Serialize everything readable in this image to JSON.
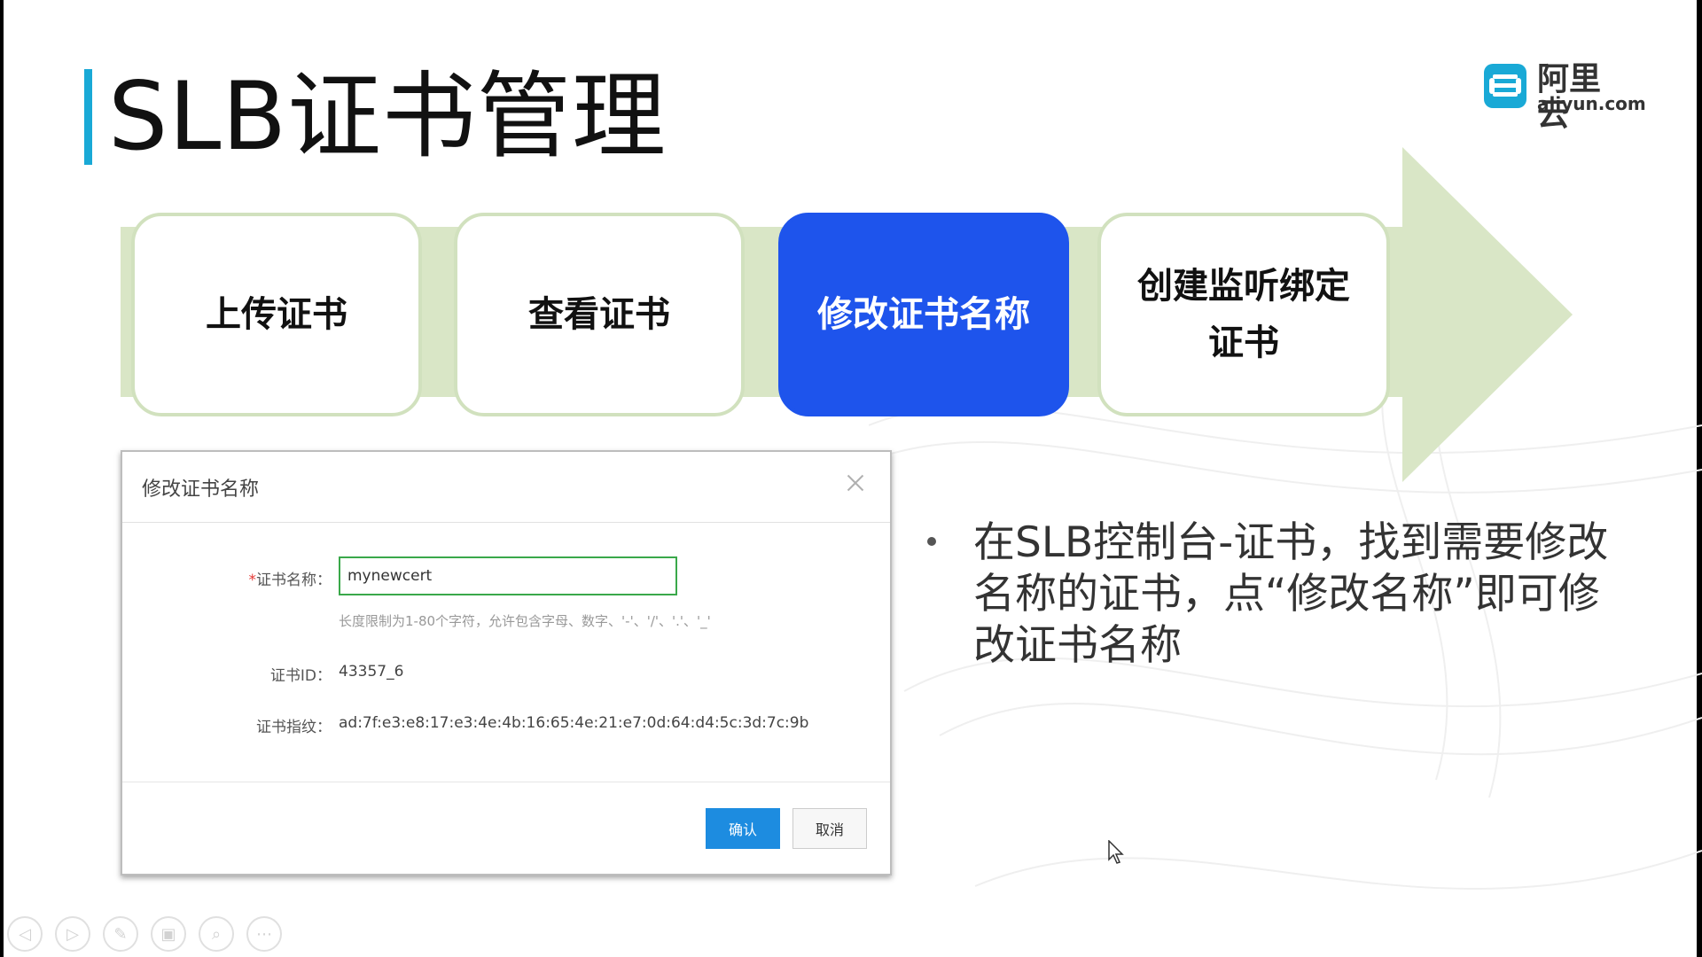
{
  "slide": {
    "title": "SLB证书管理",
    "accent_color": "#19a9d6"
  },
  "logo": {
    "cn": "阿里云",
    "en": "aliyun.com",
    "icon": "aliyun-logo-icon",
    "color": "#19a9d6"
  },
  "flow": {
    "band_color": "#d9e6c6",
    "active_color": "#1e54ec",
    "steps": [
      {
        "label": "上传证书",
        "active": false
      },
      {
        "label": "查看证书",
        "active": false
      },
      {
        "label": "修改证书名称",
        "active": true
      },
      {
        "label": "创建监听绑定证书",
        "active": false
      }
    ]
  },
  "dialog": {
    "title": "修改证书名称",
    "close_icon": "close-icon",
    "name_label_required": "*",
    "name_label": "证书名称：",
    "name_value": "mynewcert",
    "name_hint": "长度限制为1-80个字符，允许包含字母、数字、'-'、'/'、'.'、'_'",
    "id_label": "证书ID：",
    "id_value": "43357_6",
    "fingerprint_label": "证书指纹：",
    "fingerprint_value": "ad:7f:e3:e8:17:e3:4e:4b:16:65:4e:21:e7:0d:64:d4:5c:3d:7c:9b",
    "confirm_label": "确认",
    "cancel_label": "取消",
    "confirm_color": "#1d8ce0",
    "input_border_color": "#3aa84a"
  },
  "bullet": {
    "text": "在SLB控制台-证书，找到需要修改名称的证书，点“修改名称”即可修改证书名称"
  },
  "nav": {
    "buttons": [
      {
        "icon": "previous-icon",
        "glyph": "◁"
      },
      {
        "icon": "next-icon",
        "glyph": "▷"
      },
      {
        "icon": "pen-icon",
        "glyph": "✎"
      },
      {
        "icon": "slides-icon",
        "glyph": "▣"
      },
      {
        "icon": "zoom-icon",
        "glyph": "⌕"
      },
      {
        "icon": "more-icon",
        "glyph": "⋯"
      }
    ]
  }
}
